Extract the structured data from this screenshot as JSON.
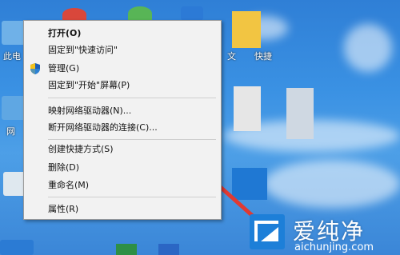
{
  "desktop": {
    "labels": {
      "this_pc": "此电",
      "network": "网",
      "file_folder": "文",
      "file_shortcut": "快捷"
    }
  },
  "context_menu": {
    "items": [
      {
        "label": "打开(O)",
        "bold": true
      },
      {
        "label": "固定到\"快速访问\""
      },
      {
        "label": "管理(G)",
        "icon": "shield-icon"
      },
      {
        "label": "固定到\"开始\"屏幕(P)"
      },
      {
        "label": "映射网络驱动器(N)..."
      },
      {
        "label": "断开网络驱动器的连接(C)..."
      },
      {
        "label": "创建快捷方式(S)"
      },
      {
        "label": "删除(D)"
      },
      {
        "label": "重命名(M)"
      },
      {
        "label": "属性(R)"
      }
    ]
  },
  "annotation": {
    "arrow_color": "#e03a33"
  },
  "watermark": {
    "text_cn": "爱纯净",
    "url": "aichunjing.com"
  }
}
